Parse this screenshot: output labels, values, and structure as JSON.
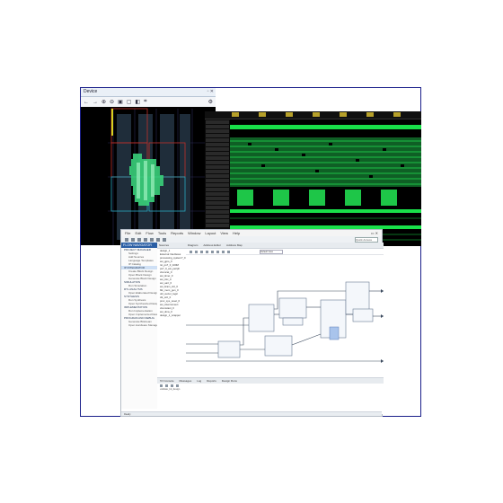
{
  "device_window": {
    "title": "Device",
    "toolbar_icons": [
      "back-icon",
      "forward-icon",
      "zoom-in-icon",
      "zoom-out-icon",
      "zoom-fit-icon",
      "zoom-area-icon",
      "select-icon",
      "route-icon",
      "settings-icon"
    ]
  },
  "waveform_window": {
    "marker_count": 7
  },
  "vivado": {
    "menu": [
      "File",
      "Edit",
      "Flow",
      "Tools",
      "Reports",
      "Window",
      "Layout",
      "View",
      "Help"
    ],
    "search_placeholder": "Quick Access",
    "flow_navigator_title": "FLOW NAVIGATOR",
    "flow_items": [
      {
        "label": "PROJECT MANAGER",
        "sub": false,
        "selected": false
      },
      {
        "label": "Settings",
        "sub": true,
        "selected": false
      },
      {
        "label": "Add Sources",
        "sub": true,
        "selected": false
      },
      {
        "label": "Language Templates",
        "sub": true,
        "selected": false
      },
      {
        "label": "IP Catalog",
        "sub": true,
        "selected": false
      },
      {
        "label": "IP INTEGRATOR",
        "sub": false,
        "selected": true
      },
      {
        "label": "Create Block Design",
        "sub": true,
        "selected": false
      },
      {
        "label": "Open Block Design",
        "sub": true,
        "selected": false
      },
      {
        "label": "Generate Block Design",
        "sub": true,
        "selected": false
      },
      {
        "label": "SIMULATION",
        "sub": false,
        "selected": false
      },
      {
        "label": "Run Simulation",
        "sub": true,
        "selected": false
      },
      {
        "label": "RTL ANALYSIS",
        "sub": false,
        "selected": false
      },
      {
        "label": "Open Elaborated Design",
        "sub": true,
        "selected": false
      },
      {
        "label": "SYNTHESIS",
        "sub": false,
        "selected": false
      },
      {
        "label": "Run Synthesis",
        "sub": true,
        "selected": false
      },
      {
        "label": "Open Synthesized Design",
        "sub": true,
        "selected": false
      },
      {
        "label": "IMPLEMENTATION",
        "sub": false,
        "selected": false
      },
      {
        "label": "Run Implementation",
        "sub": true,
        "selected": false
      },
      {
        "label": "Open Implemented Design",
        "sub": true,
        "selected": false
      },
      {
        "label": "PROGRAM AND DEBUG",
        "sub": false,
        "selected": false
      },
      {
        "label": "Generate Bitstream",
        "sub": true,
        "selected": false
      },
      {
        "label": "Open Hardware Manager",
        "sub": true,
        "selected": false
      }
    ],
    "sources_title": "Sources",
    "sources_items": [
      "design_1",
      "External Interfaces",
      "processing_system7_0",
      "axi_gpio_0",
      "rst_ps7_0_100M",
      "ps7_0_axi_periph",
      "xlconcat_0",
      "axi_timer_0",
      "axi_intc_0",
      "axi_uart_0",
      "axi_bram_ctrl_0",
      "blk_mem_gen_0",
      "util_vector_logic",
      "clk_wiz_0",
      "proc_sys_reset_0",
      "axi_interconnect",
      "xlconstant_0",
      "axi_dma_0",
      "design_1_wrapper"
    ],
    "diagram_tabs": [
      "Diagram",
      "Address Editor",
      "Address Map"
    ],
    "diagram_selector": "Default View",
    "console_tabs": [
      "Tcl Console",
      "Messages",
      "Log",
      "Reports",
      "Design Runs"
    ],
    "console_line": "validate_bd_design",
    "status_text": "Ready"
  }
}
